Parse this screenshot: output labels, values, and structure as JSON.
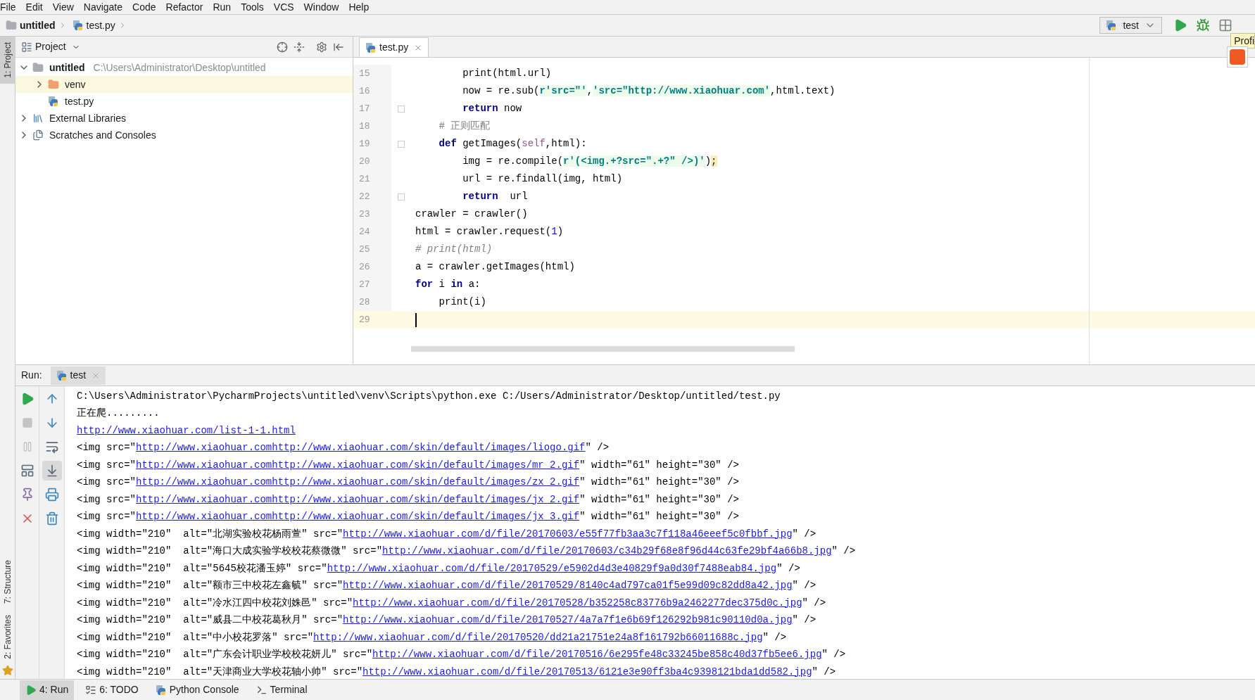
{
  "menu": [
    "File",
    "Edit",
    "View",
    "Navigate",
    "Code",
    "Refactor",
    "Run",
    "Tools",
    "VCS",
    "Window",
    "Help"
  ],
  "breadcrumbs": [
    {
      "label": "untitled",
      "kind": "folder"
    },
    {
      "label": "test.py",
      "kind": "python"
    }
  ],
  "toolbar": {
    "run_config": "test",
    "tooltip": "Profi"
  },
  "side_tabs": [
    {
      "label": "1: Project",
      "selected": true
    },
    {
      "label": "7: Structure",
      "selected": false
    },
    {
      "label": "2: Favorites",
      "selected": false
    }
  ],
  "project_panel": {
    "title": "Project",
    "tree": [
      {
        "label": "untitled",
        "path": "C:\\Users\\Administrator\\Desktop\\untitled",
        "kind": "folder",
        "expanded": true,
        "selected": false,
        "children": [
          {
            "label": "venv",
            "kind": "venv",
            "expanded": false,
            "selected": true
          },
          {
            "label": "test.py",
            "kind": "python",
            "selected": false
          }
        ]
      },
      {
        "label": "External Libraries",
        "kind": "libraries",
        "expanded": false,
        "selected": false
      },
      {
        "label": "Scratches and Consoles",
        "kind": "scratches",
        "expanded": false,
        "selected": false
      }
    ]
  },
  "editor": {
    "tabs": [
      {
        "label": "test.py",
        "selected": true
      }
    ],
    "lines": [
      {
        "number": "15",
        "current": false,
        "fold_marker": false,
        "tokens": [
          {
            "kind": "plain",
            "text": "        print(html.url)"
          }
        ]
      },
      {
        "number": "16",
        "current": false,
        "fold_marker": false,
        "tokens": [
          {
            "kind": "plain",
            "text": "        now = re.sub("
          },
          {
            "kind": "string",
            "text": "r'src=\"'"
          },
          {
            "kind": "plain",
            "text": ","
          },
          {
            "kind": "string",
            "text": "'src=\"http://www.xiaohuar.com'"
          },
          {
            "kind": "plain",
            "text": ",html.text)"
          }
        ]
      },
      {
        "number": "17",
        "current": false,
        "fold_marker": true,
        "tokens": [
          {
            "kind": "keyword",
            "text": "        return"
          },
          {
            "kind": "plain",
            "text": " now"
          }
        ]
      },
      {
        "number": "18",
        "current": false,
        "fold_marker": false,
        "tokens": [
          {
            "kind": "comment",
            "text": "    # 正则匹配"
          }
        ]
      },
      {
        "number": "19",
        "current": false,
        "fold_marker": true,
        "tokens": [
          {
            "kind": "keyword",
            "text": "    def"
          },
          {
            "kind": "plain",
            "text": " getImages("
          },
          {
            "kind": "self",
            "text": "self"
          },
          {
            "kind": "plain",
            "text": ",html):"
          }
        ]
      },
      {
        "number": "20",
        "current": false,
        "fold_marker": false,
        "tokens": [
          {
            "kind": "plain",
            "text": "        img = re.compile("
          },
          {
            "kind": "string",
            "text": "r'(<img.+?src=\".+?\" />)'"
          },
          {
            "kind": "plain",
            "text": ")"
          },
          {
            "kind": "warning",
            "text": ";"
          }
        ]
      },
      {
        "number": "21",
        "current": false,
        "fold_marker": false,
        "tokens": [
          {
            "kind": "plain",
            "text": "        url = re.findall(img, html)"
          }
        ]
      },
      {
        "number": "22",
        "current": false,
        "fold_marker": true,
        "tokens": [
          {
            "kind": "keyword",
            "text": "        return"
          },
          {
            "kind": "plain",
            "text": "  url"
          }
        ]
      },
      {
        "number": "23",
        "current": false,
        "fold_marker": false,
        "tokens": [
          {
            "kind": "plain",
            "text": "crawler = crawler()"
          }
        ]
      },
      {
        "number": "24",
        "current": false,
        "fold_marker": false,
        "tokens": [
          {
            "kind": "plain",
            "text": "html = crawler.request("
          },
          {
            "kind": "number",
            "text": "1"
          },
          {
            "kind": "plain",
            "text": ")"
          }
        ]
      },
      {
        "number": "25",
        "current": false,
        "fold_marker": false,
        "tokens": [
          {
            "kind": "comment_italic",
            "text": "# print(html)"
          }
        ]
      },
      {
        "number": "26",
        "current": false,
        "fold_marker": false,
        "tokens": [
          {
            "kind": "plain",
            "text": "a = crawler.getImages(html)"
          }
        ]
      },
      {
        "number": "27",
        "current": false,
        "fold_marker": false,
        "tokens": [
          {
            "kind": "keyword",
            "text": "for"
          },
          {
            "kind": "plain",
            "text": " i "
          },
          {
            "kind": "keyword",
            "text": "in"
          },
          {
            "kind": "plain",
            "text": " a:"
          }
        ]
      },
      {
        "number": "28",
        "current": false,
        "fold_marker": false,
        "tokens": [
          {
            "kind": "plain",
            "text": "    print(i)"
          }
        ]
      },
      {
        "number": "29",
        "current": true,
        "fold_marker": false
      }
    ]
  },
  "run_panel": {
    "label": "Run:",
    "tabs": [
      {
        "label": "test",
        "selected": true
      }
    ],
    "output": [
      {
        "parts": [
          {
            "kind": "text",
            "text": "C:\\Users\\Administrator\\PycharmProjects\\untitled\\venv\\Scripts\\python.exe C:/Users/Administrator/Desktop/untitled/test.py"
          }
        ]
      },
      {
        "parts": [
          {
            "kind": "text",
            "text": "正在爬........."
          }
        ]
      },
      {
        "parts": [
          {
            "kind": "link",
            "text": "http://www.xiaohuar.com/list-1-1.html"
          }
        ]
      },
      {
        "parts": [
          {
            "kind": "text",
            "text": "<img src=\""
          },
          {
            "kind": "link",
            "text": "http://www.xiaohuar.comhttp://www.xiaohuar.com/skin/default/images/liogo.gif"
          },
          {
            "kind": "text",
            "text": "\" />"
          }
        ]
      },
      {
        "parts": [
          {
            "kind": "text",
            "text": "<img src=\""
          },
          {
            "kind": "link",
            "text": "http://www.xiaohuar.comhttp://www.xiaohuar.com/skin/default/images/mr_2.gif"
          },
          {
            "kind": "text",
            "text": "\" width=\"61\" height=\"30\" />"
          }
        ]
      },
      {
        "parts": [
          {
            "kind": "text",
            "text": "<img src=\""
          },
          {
            "kind": "link",
            "text": "http://www.xiaohuar.comhttp://www.xiaohuar.com/skin/default/images/zx_2.gif"
          },
          {
            "kind": "text",
            "text": "\" width=\"61\" height=\"30\" />"
          }
        ]
      },
      {
        "parts": [
          {
            "kind": "text",
            "text": "<img src=\""
          },
          {
            "kind": "link",
            "text": "http://www.xiaohuar.comhttp://www.xiaohuar.com/skin/default/images/jx_2.gif"
          },
          {
            "kind": "text",
            "text": "\" width=\"61\" height=\"30\" />"
          }
        ]
      },
      {
        "parts": [
          {
            "kind": "text",
            "text": "<img src=\""
          },
          {
            "kind": "link",
            "text": "http://www.xiaohuar.comhttp://www.xiaohuar.com/skin/default/images/jx_3.gif"
          },
          {
            "kind": "text",
            "text": "\" width=\"61\" height=\"30\" />"
          }
        ]
      },
      {
        "parts": [
          {
            "kind": "text",
            "text": "<img width=\"210\"  alt=\"北湖实验校花杨雨萱\" src=\""
          },
          {
            "kind": "link",
            "text": "http://www.xiaohuar.com/d/file/20170603/e55f77fb3aa3c7f118a46eeef5c0fbbf.jpg"
          },
          {
            "kind": "text",
            "text": "\" />"
          }
        ]
      },
      {
        "parts": [
          {
            "kind": "text",
            "text": "<img width=\"210\"  alt=\"海口大成实验学校校花蔡微微\" src=\""
          },
          {
            "kind": "link",
            "text": "http://www.xiaohuar.com/d/file/20170603/c34b29f68e8f96d44c63fe29bf4a66b8.jpg"
          },
          {
            "kind": "text",
            "text": "\" />"
          }
        ]
      },
      {
        "parts": [
          {
            "kind": "text",
            "text": "<img width=\"210\"  alt=\"5645校花潘玉婷\" src=\""
          },
          {
            "kind": "link",
            "text": "http://www.xiaohuar.com/d/file/20170529/e5902d4d3e40829f9a0d30f7488eab84.jpg"
          },
          {
            "kind": "text",
            "text": "\" />"
          }
        ]
      },
      {
        "parts": [
          {
            "kind": "text",
            "text": "<img width=\"210\"  alt=\"额市三中校花左鑫毓\" src=\""
          },
          {
            "kind": "link",
            "text": "http://www.xiaohuar.com/d/file/20170529/8140c4ad797ca01f5e99d09c82dd8a42.jpg"
          },
          {
            "kind": "text",
            "text": "\" />"
          }
        ]
      },
      {
        "parts": [
          {
            "kind": "text",
            "text": "<img width=\"210\"  alt=\"冷水江四中校花刘姝邑\" src=\""
          },
          {
            "kind": "link",
            "text": "http://www.xiaohuar.com/d/file/20170528/b352258c83776b9a2462277dec375d0c.jpg"
          },
          {
            "kind": "text",
            "text": "\" />"
          }
        ]
      },
      {
        "parts": [
          {
            "kind": "text",
            "text": "<img width=\"210\"  alt=\"威县二中校花葛秋月\" src=\""
          },
          {
            "kind": "link",
            "text": "http://www.xiaohuar.com/d/file/20170527/4a7a7f1e6b69f126292b981c90110d0a.jpg"
          },
          {
            "kind": "text",
            "text": "\" />"
          }
        ]
      },
      {
        "parts": [
          {
            "kind": "text",
            "text": "<img width=\"210\"  alt=\"中小校花罗落\" src=\""
          },
          {
            "kind": "link",
            "text": "http://www.xiaohuar.com/d/file/20170520/dd21a21751e24a8f161792b66011688c.jpg"
          },
          {
            "kind": "text",
            "text": "\" />"
          }
        ]
      },
      {
        "parts": [
          {
            "kind": "text",
            "text": "<img width=\"210\"  alt=\"广东会计职业学校校花妍儿\" src=\""
          },
          {
            "kind": "link",
            "text": "http://www.xiaohuar.com/d/file/20170516/6e295fe48c33245be858c40d37fb5ee6.jpg"
          },
          {
            "kind": "text",
            "text": "\" />"
          }
        ]
      },
      {
        "parts": [
          {
            "kind": "text",
            "text": "<img width=\"210\"  alt=\"天津商业大学校花轴小帅\" src=\""
          },
          {
            "kind": "link",
            "text": "http://www.xiaohuar.com/d/file/20170513/6121e3e90ff3ba4c9398121bda1dd582.jpg"
          },
          {
            "kind": "text",
            "text": "\" />"
          }
        ]
      }
    ]
  },
  "bottom_tabs": [
    {
      "label": "4: Run",
      "kind": "run",
      "selected": true
    },
    {
      "label": "6: TODO",
      "kind": "todo",
      "selected": false
    },
    {
      "label": "Python Console",
      "kind": "console",
      "selected": false
    },
    {
      "label": "Terminal",
      "kind": "terminal",
      "selected": false
    }
  ]
}
